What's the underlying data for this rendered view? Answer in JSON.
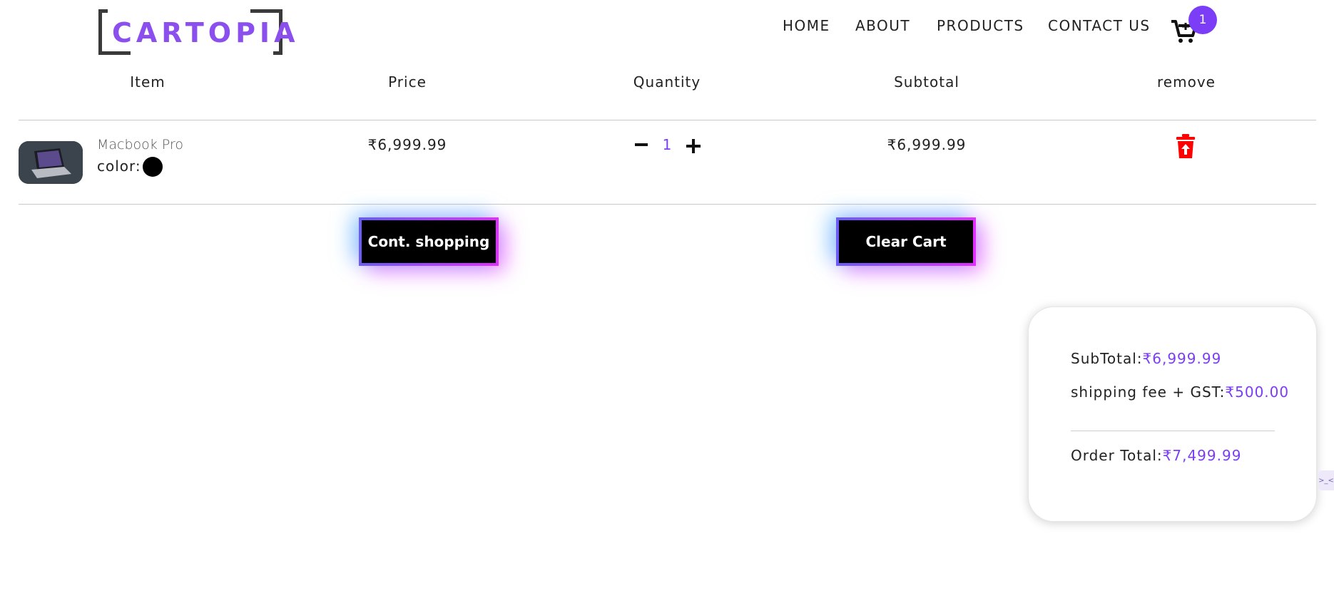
{
  "header": {
    "logo_text": "CARTOPIA",
    "nav": [
      "HOME",
      "ABOUT",
      "PRODUCTS",
      "CONTACT US"
    ],
    "cart_count": "1",
    "cart_icon": "cart-icon"
  },
  "table": {
    "headers": [
      "Item",
      "Price",
      "Quantity",
      "Subtotal",
      "remove"
    ],
    "rows": [
      {
        "name": "Macbook Pro",
        "color_label": "color:",
        "color": "#000000",
        "price": "₹6,999.99",
        "quantity": "1",
        "subtotal": "₹6,999.99"
      }
    ]
  },
  "actions": {
    "continue": "Cont. shopping",
    "clear": "Clear Cart"
  },
  "summary": {
    "subtotal_label": "SubTotal:",
    "subtotal_value": "₹6,999.99",
    "shipping_label": "shipping fee + GST:",
    "shipping_value": "₹500.00",
    "total_label": "Order Total:",
    "total_value": "₹7,499.99"
  },
  "side_tab": ">_<",
  "accent": "#7b3df5"
}
